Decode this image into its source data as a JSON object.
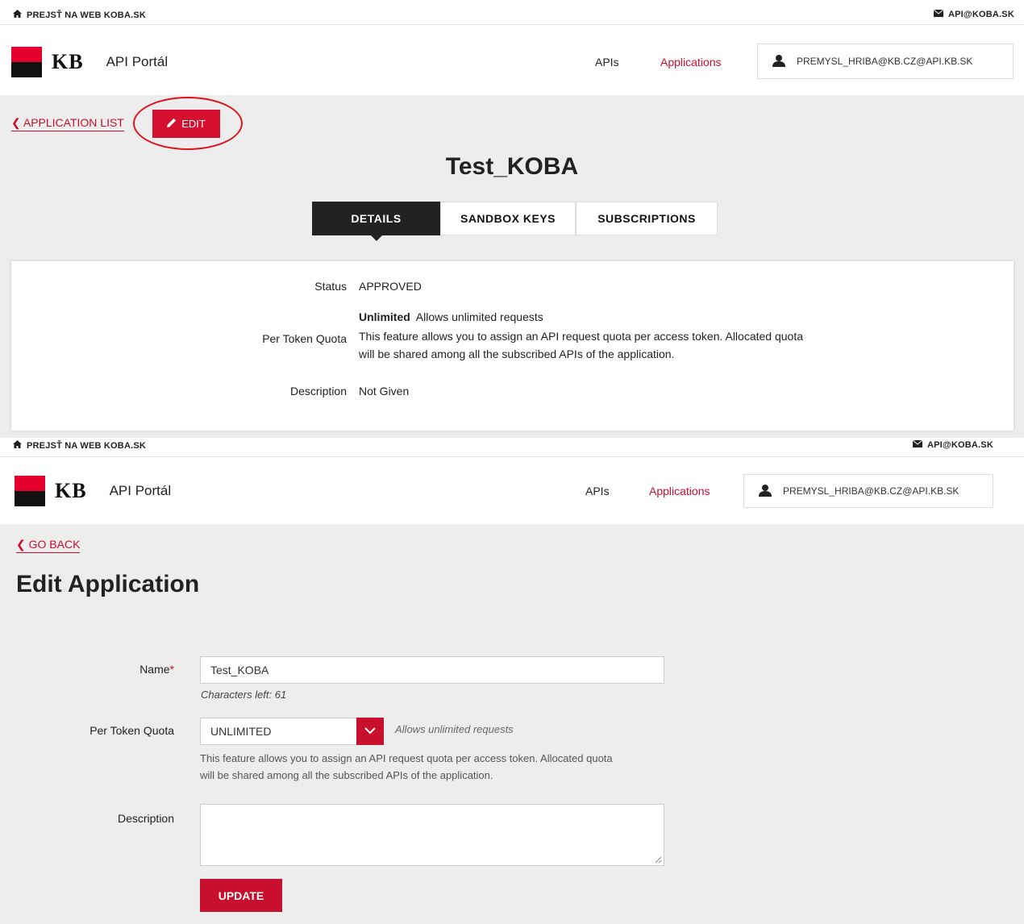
{
  "screen1": {
    "topbar": {
      "home_link": "PREJSŤ NA WEB KOBA.SK",
      "email": "API@KOBA.SK"
    },
    "header": {
      "logo_text": "KB",
      "portal_title": "API Portál",
      "nav_apis": "APIs",
      "nav_applications": "Applications",
      "user": "PREMYSL_HRIBA@KB.CZ@API.KB.SK"
    },
    "back_link": "APPLICATION LIST",
    "edit_button": "EDIT",
    "app_title": "Test_KOBA",
    "tabs": [
      "DETAILS",
      "SANDBOX KEYS",
      "SUBSCRIPTIONS"
    ],
    "details": {
      "status_label": "Status",
      "status_value": "APPROVED",
      "quota_label": "Per Token Quota",
      "quota_name": "Unlimited",
      "quota_desc": "Allows unlimited requests",
      "quota_help_1": "This feature allows you to assign an API request quota per access token. Allocated quota",
      "quota_help_2": "will be shared among all the subscribed APIs of the application.",
      "description_label": "Description",
      "description_value": "Not Given"
    }
  },
  "screen2": {
    "topbar": {
      "home_link": "PREJSŤ NA WEB KOBA.SK",
      "email": "API@KOBA.SK"
    },
    "header": {
      "logo_text": "KB",
      "portal_title": "API Portál",
      "nav_apis": "APIs",
      "nav_applications": "Applications",
      "user": "PREMYSL_HRIBA@KB.CZ@API.KB.SK"
    },
    "back_link": "GO BACK",
    "page_title": "Edit Application",
    "form": {
      "name_label": "Name",
      "required_mark": "*",
      "name_value": "Test_KOBA",
      "chars_left": "Characters left: 61",
      "quota_label": "Per Token Quota",
      "quota_value": "UNLIMITED",
      "quota_desc": "Allows unlimited requests",
      "quota_help_1": "This feature allows you to assign an API request quota per access token. Allocated quota",
      "quota_help_2": "will be shared among all the subscribed APIs of the application.",
      "description_label": "Description",
      "update_button": "UPDATE"
    }
  },
  "colors": {
    "brand_red": "#c8102e",
    "annotation_red": "#e0141d",
    "band_gray": "#ededed"
  }
}
